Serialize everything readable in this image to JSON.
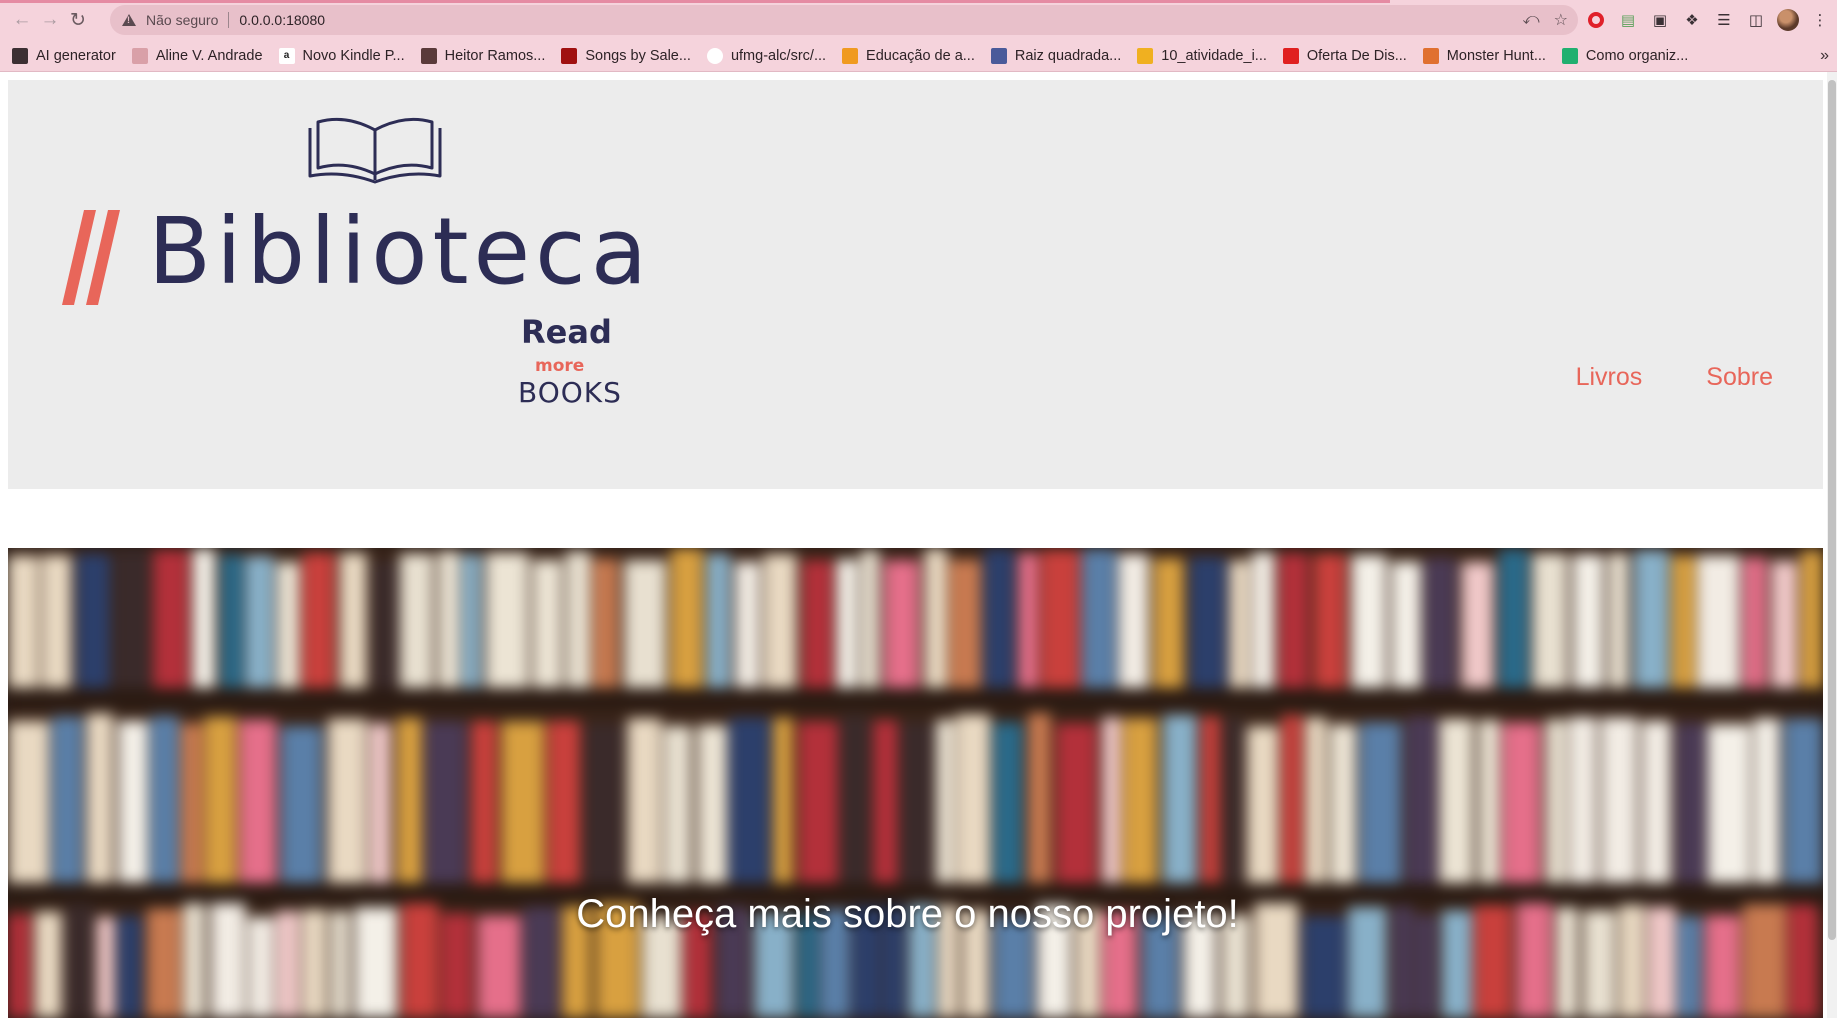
{
  "browser": {
    "security_label": "Não seguro",
    "url": "0.0.0.0:18080",
    "bookmarks": [
      {
        "label": "AI generator",
        "icon": "folder-icon",
        "color": "#3c2f33"
      },
      {
        "label": "Aline V. Andrade",
        "icon": "site-favicon",
        "color": "#d9a0a8"
      },
      {
        "label": "Novo Kindle P...",
        "icon": "amazon-icon",
        "color": "#ffffff"
      },
      {
        "label": "Heitor Ramos...",
        "icon": "site-favicon",
        "color": "#5a3a3a"
      },
      {
        "label": "Songs by Sale...",
        "icon": "site-favicon",
        "color": "#a01010"
      },
      {
        "label": "ufmg-alc/src/...",
        "icon": "github-icon",
        "color": "#ffffff"
      },
      {
        "label": "Educação de a...",
        "icon": "site-favicon",
        "color": "#f09a20"
      },
      {
        "label": "Raiz quadrada...",
        "icon": "site-favicon",
        "color": "#4a5a9a"
      },
      {
        "label": "10_atividade_i...",
        "icon": "site-favicon",
        "color": "#f0b020"
      },
      {
        "label": "Oferta De Dis...",
        "icon": "site-favicon",
        "color": "#e02020"
      },
      {
        "label": "Monster Hunt...",
        "icon": "site-favicon",
        "color": "#e07030"
      },
      {
        "label": "Como organiz...",
        "icon": "site-favicon",
        "color": "#20b070"
      }
    ],
    "more_bookmarks_icon": "chevron-double-right-icon"
  },
  "site": {
    "logo_name": "Biblioteca",
    "logo_tagline_read": "Read",
    "logo_tagline_more": "more",
    "logo_tagline_books": "BOOKS",
    "nav": [
      {
        "label": "Livros"
      },
      {
        "label": "Sobre"
      }
    ],
    "hero_caption": "Conheça mais sobre o nosso projeto!"
  },
  "colors": {
    "accent": "#e8665a",
    "logo_navy": "#2d2d55",
    "header_bg": "#ececec",
    "chrome_bg": "#f5d3dc"
  }
}
